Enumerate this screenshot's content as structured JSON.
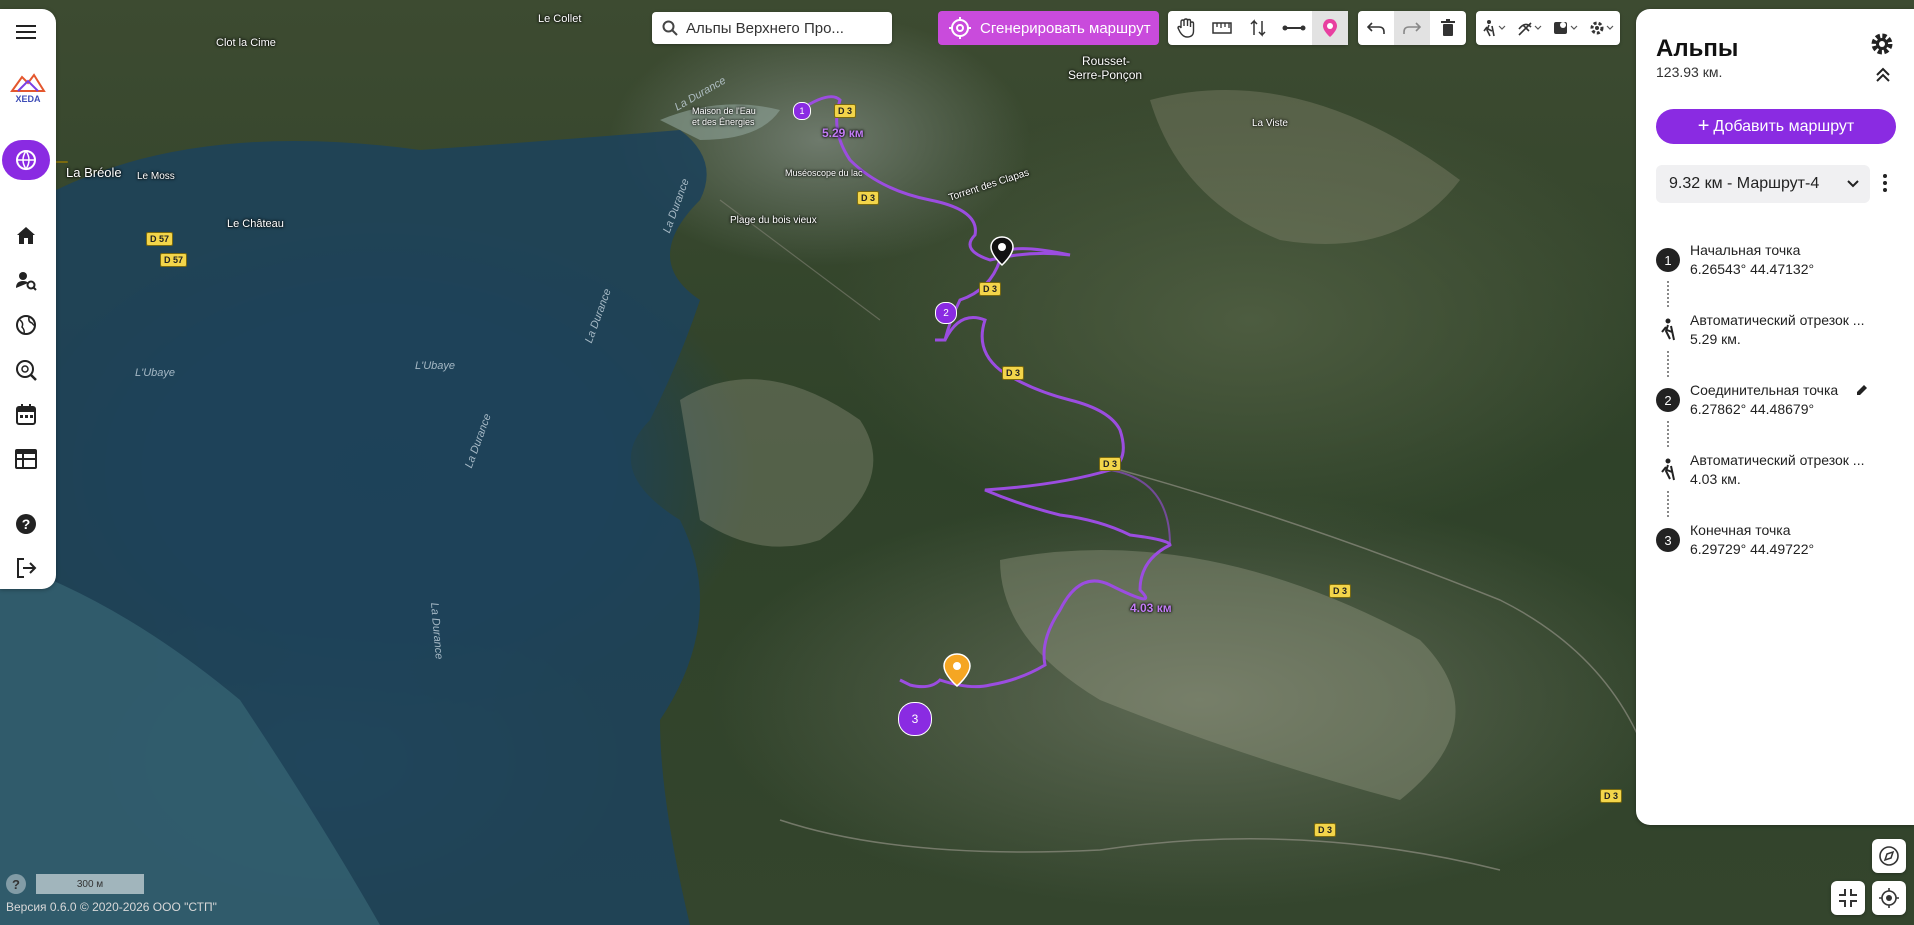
{
  "map": {
    "places": [
      "Le Collet",
      "Clot la Cime",
      "La Bréole",
      "Le Moss",
      "Le Château",
      "Maison de l'Eau",
      "et des Énergies",
      "Muséoscope du lac",
      "Plage du bois vieux",
      "Rousset-",
      "Serre-Ponçon",
      "La Viste",
      "Torrent des Clapas"
    ],
    "water_labels": [
      "La Durance",
      "La Durance",
      "L'Ubaye",
      "La Durance",
      "La Durance",
      "La Durance",
      "L'Ubaye"
    ],
    "roads": [
      "D 3",
      "D 3",
      "D 3",
      "D 3",
      "D 3",
      "D 3",
      "D 3",
      "D 3",
      "D 57",
      "D 57"
    ],
    "segment_labels": [
      "5.29 км",
      "4.03 км"
    ],
    "markers": [
      "1",
      "2",
      "3"
    ],
    "scale": "300 м",
    "version": "Версия 0.6.0 © 2020-2026 ООО \"СТП\""
  },
  "search": {
    "value": "Альпы Верхнего Про..."
  },
  "toolbar": {
    "generate_label": "Сгенерировать маршрут"
  },
  "panel": {
    "title": "Альпы",
    "distance": "123.93 км.",
    "add_route_label": "Добавить маршрут",
    "route_selected": "9.32 км - Маршрут-4",
    "items": [
      {
        "num": "1",
        "title": "Начальная точка",
        "sub": "6.26543° 44.47132°"
      },
      {
        "title": "Автоматический отрезок ...",
        "sub": "5.29 км."
      },
      {
        "num": "2",
        "title": "Соединительная точка",
        "sub": "6.27862° 44.48679°"
      },
      {
        "title": "Автоматический отрезок ...",
        "sub": "4.03 км."
      },
      {
        "num": "3",
        "title": "Конечная точка",
        "sub": "6.29729° 44.49722°"
      }
    ]
  },
  "brand": {
    "logo_text": "XEDA",
    "accent": "#8a2be2",
    "generate_color": "#c94bdc"
  }
}
